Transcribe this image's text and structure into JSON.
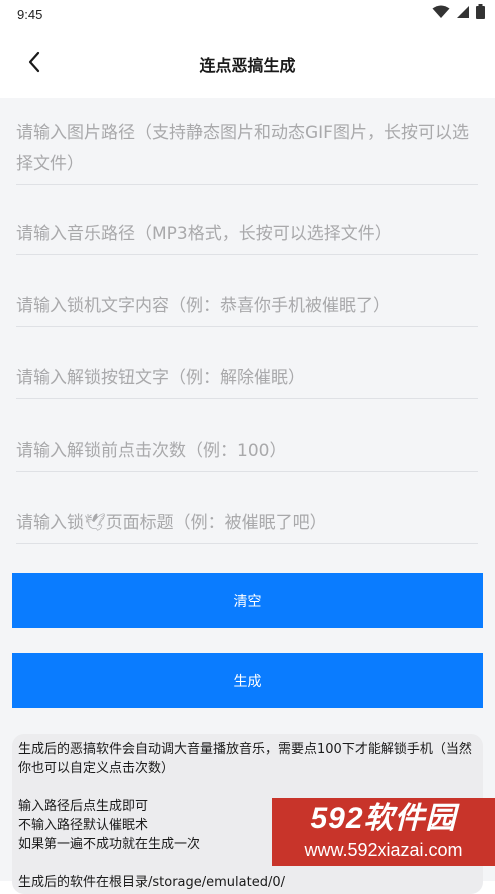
{
  "status_bar": {
    "time": "9:45",
    "icons": [
      "wifi-icon",
      "signal-icon",
      "battery-icon"
    ]
  },
  "app_bar": {
    "back_icon": "chevron-left-icon",
    "title": "连点恶搞生成"
  },
  "form": {
    "image_path_placeholder": "请输入图片路径（支持静态图片和动态GIF图片，长按可以选择文件）",
    "music_path_placeholder": "请输入音乐路径（MP3格式，长按可以选择文件）",
    "lock_text_placeholder": "请输入锁机文字内容（例：恭喜你手机被催眠了）",
    "unlock_button_text_placeholder": "请输入解锁按钮文字（例：解除催眠）",
    "click_count_placeholder": "请输入解锁前点击次数（例：100）",
    "page_title_placeholder": "请输入锁🕊页面标题（例：被催眠了吧）"
  },
  "buttons": {
    "clear_label": "清空",
    "generate_label": "生成"
  },
  "info": {
    "line1": "生成后的恶搞软件会自动调大音量播放音乐，需要点100下才能解锁手机（当然你也可以自定义点击次数）",
    "line2": "输入路径后点生成即可",
    "line3": "不输入路径默认催眠术",
    "line4": "如果第一遍不成功就在生成一次",
    "line5": "生成后的软件在根目录/storage/emulated/0/"
  },
  "watermark": {
    "brand": "592软件园",
    "url": "www.592xiazai.com"
  },
  "colors": {
    "accent": "#0a7cff",
    "background": "#f4f5f7",
    "placeholder": "#a9a9ab",
    "watermark": "#c8342a"
  }
}
